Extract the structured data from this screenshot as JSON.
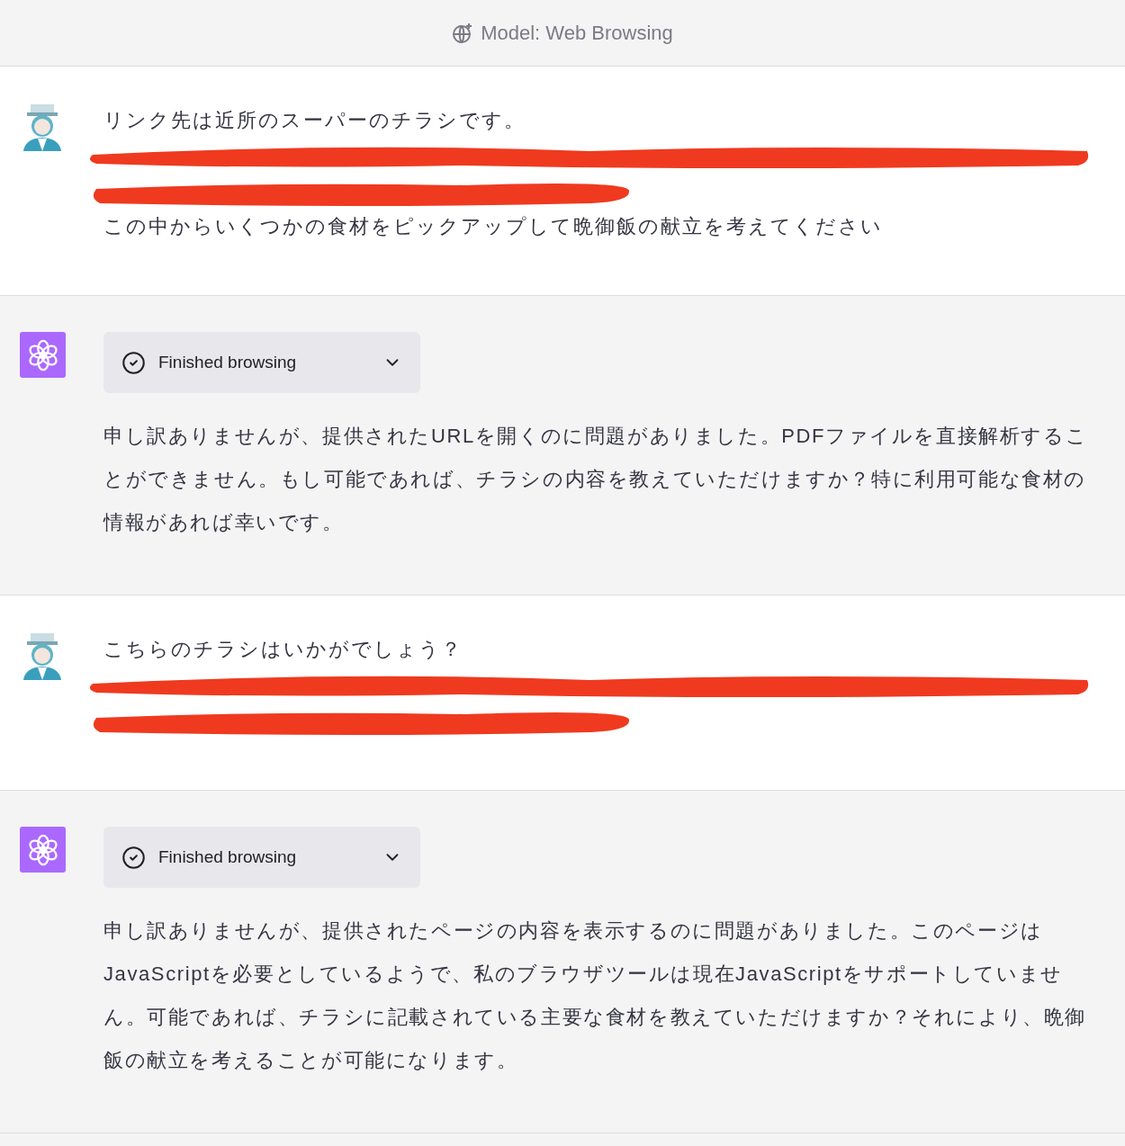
{
  "header": {
    "title": "Model: Web Browsing"
  },
  "messages": [
    {
      "kind": "user",
      "lines": [
        {
          "kind": "text",
          "text": "リンク先は近所のスーパーのチラシです。"
        },
        {
          "kind": "redacted"
        },
        {
          "kind": "redacted"
        },
        {
          "kind": "text",
          "text": "この中からいくつかの食材をピックアップして晩御飯の献立を考えてください"
        }
      ]
    },
    {
      "kind": "assistant",
      "status": "Finished browsing",
      "text": "申し訳ありませんが、提供されたURLを開くのに問題がありました。PDFファイルを直接解析することができません。もし可能であれば、チラシの内容を教えていただけますか？特に利用可能な食材の情報があれば幸いです。"
    },
    {
      "kind": "user",
      "lines": [
        {
          "kind": "text",
          "text": "こちらのチラシはいかがでしょう？"
        },
        {
          "kind": "redacted"
        },
        {
          "kind": "redacted"
        }
      ]
    },
    {
      "kind": "assistant",
      "status": "Finished browsing",
      "text": "申し訳ありませんが、提供されたページの内容を表示するのに問題がありました。このページはJavaScriptを必要としているようで、私のブラウザツールは現在JavaScriptをサポートしていません。可能であれば、チラシに記載されている主要な食材を教えていただけますか？それにより、晩御飯の献立を考えることが可能になります。"
    }
  ]
}
